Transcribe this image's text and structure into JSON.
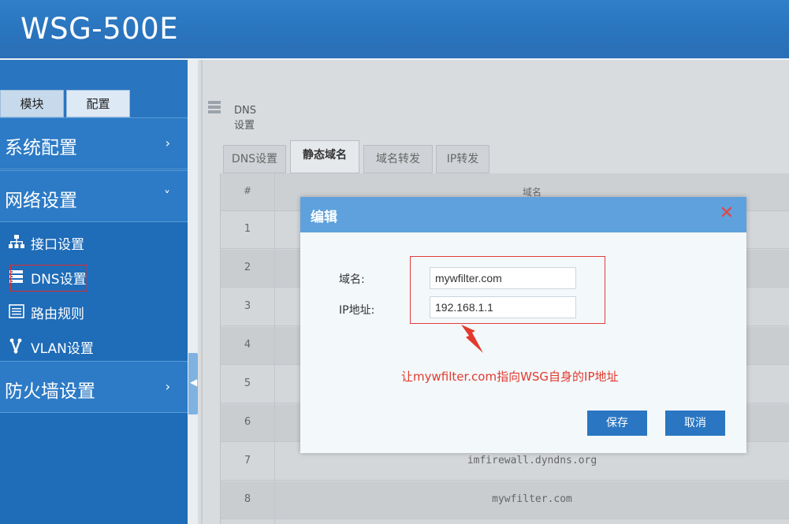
{
  "app": {
    "title": "WSG-500E"
  },
  "sidebar": {
    "tabs": [
      {
        "label": "模块"
      },
      {
        "label": "配置"
      }
    ],
    "sections": [
      {
        "label": "系统配置",
        "arrow": "›"
      },
      {
        "label": "网络设置",
        "arrow": "˅"
      },
      {
        "label": "防火墙设置",
        "arrow": "›"
      }
    ],
    "items": [
      {
        "label": "接口设置",
        "icon": "network-icon"
      },
      {
        "label": "DNS设置",
        "icon": "server-icon"
      },
      {
        "label": "路由规则",
        "icon": "list-icon"
      },
      {
        "label": "VLAN设置",
        "icon": "vlan-icon"
      }
    ]
  },
  "page": {
    "title": "DNS设置",
    "tabs": [
      {
        "label": "DNS设置"
      },
      {
        "label": "静态域名"
      },
      {
        "label": "域名转发"
      },
      {
        "label": "IP转发"
      }
    ],
    "table": {
      "headers": [
        "#",
        "域名"
      ],
      "rows": [
        {
          "num": "1",
          "domain": ""
        },
        {
          "num": "2",
          "domain": ""
        },
        {
          "num": "3",
          "domain": ""
        },
        {
          "num": "4",
          "domain": ""
        },
        {
          "num": "5",
          "domain": ""
        },
        {
          "num": "6",
          "domain": ""
        },
        {
          "num": "7",
          "domain": "imfirewall.dyndns.org"
        },
        {
          "num": "8",
          "domain": "mywfilter.com"
        }
      ]
    }
  },
  "modal": {
    "title": "编辑",
    "close": "✕",
    "domain_label": "域名:",
    "domain_value": "mywfilter.com",
    "ip_label": "IP地址:",
    "ip_value": "192.168.1.1",
    "annotation": "让mywfilter.com指向WSG自身的IP地址",
    "save": "保存",
    "cancel": "取消"
  },
  "colors": {
    "header": "#2a73bd",
    "sidebar": "#1f6cb8",
    "modal_header": "#5ea1dc",
    "button": "#2a76c2",
    "annotation": "#e33a2e"
  }
}
